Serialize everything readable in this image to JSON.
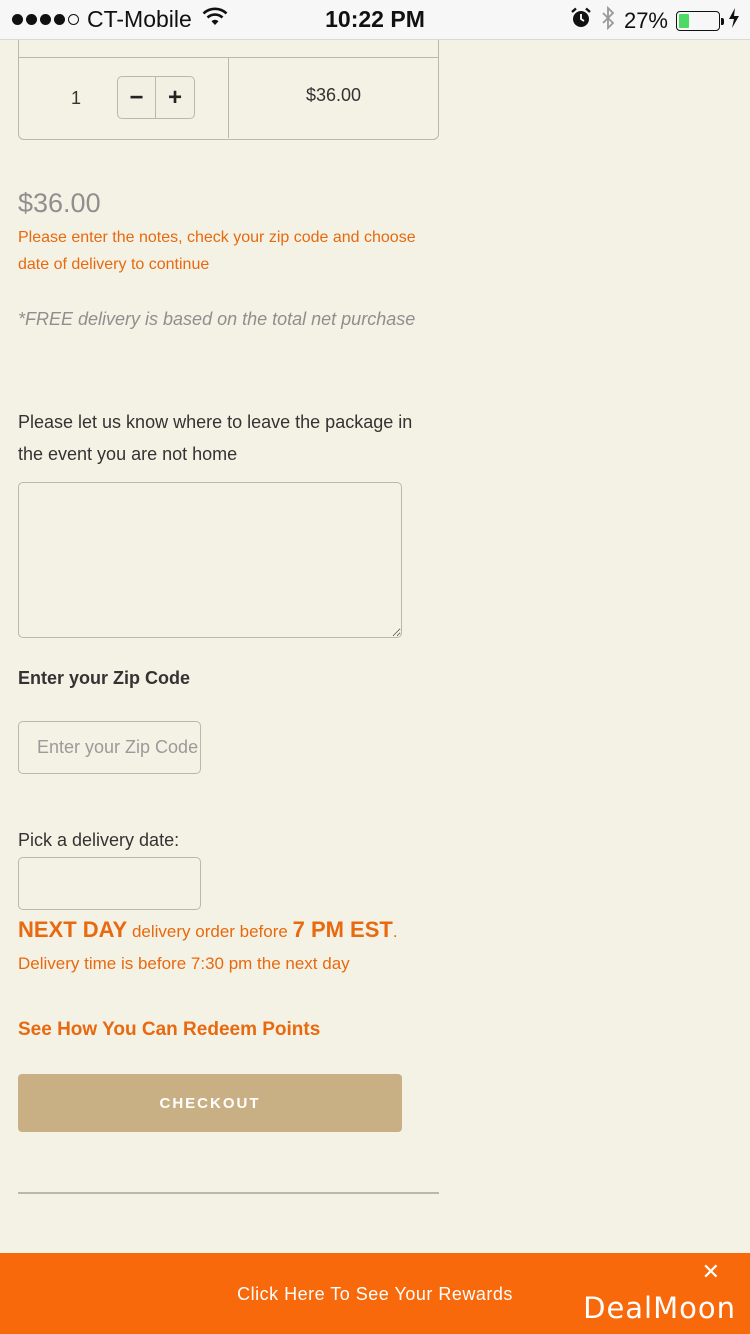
{
  "status_bar": {
    "carrier": "CT-Mobile",
    "time": "10:22 PM",
    "battery_percent": "27%",
    "battery_level": 0.27,
    "signal_bars_filled": 4,
    "icons": [
      "wifi-icon",
      "alarm-icon",
      "bluetooth-icon",
      "battery-icon",
      "charging-icon"
    ]
  },
  "cart": {
    "quantity": "1",
    "minus_label": "−",
    "plus_label": "+",
    "line_total": "$36.00"
  },
  "summary": {
    "total": "$36.00",
    "warning": "Please enter the notes, check your zip code and choose date of delivery to continue",
    "free_delivery_note": "*FREE delivery is based on the total net purchase"
  },
  "notes": {
    "label": "Please let us know where to leave the package in the event you are not home",
    "value": ""
  },
  "zip": {
    "label": "Enter your Zip Code",
    "placeholder": "Enter your Zip Code",
    "value": ""
  },
  "delivery_date": {
    "label": "Pick a delivery date:",
    "value": ""
  },
  "delivery_info": {
    "next_day": "NEXT DAY",
    "middle": " delivery order before ",
    "cutoff": "7 PM EST",
    "end": ".",
    "time_note": "Delivery time is before 7:30 pm the next day"
  },
  "redeem_link": "See How You Can Redeem Points",
  "checkout_label": "CHECKOUT",
  "banner": {
    "text": "Click Here To See Your Rewards",
    "close": "✕",
    "logo": "DealMoon"
  },
  "colors": {
    "background": "#f3f2e5",
    "accent_orange": "#e8690f",
    "checkout_button": "#c9b084",
    "banner": "#f7690a"
  }
}
